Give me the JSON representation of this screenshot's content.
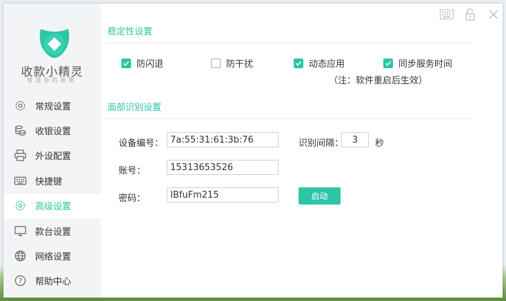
{
  "app": {
    "name": "收款小精灵",
    "slogan": "智慧你的收银"
  },
  "colors": {
    "accent": "#2bc6a6"
  },
  "sidebar": {
    "items": [
      {
        "label": "常规设置",
        "icon": "gear-icon",
        "active": false
      },
      {
        "label": "收银设置",
        "icon": "coins-icon",
        "active": false
      },
      {
        "label": "外设配置",
        "icon": "printer-icon",
        "active": false
      },
      {
        "label": "快捷键",
        "icon": "keyboard-icon",
        "active": false
      },
      {
        "label": "高级设置",
        "icon": "advanced-gear-icon",
        "active": true
      },
      {
        "label": "款台设置",
        "icon": "monitor-icon",
        "active": false
      },
      {
        "label": "网络设置",
        "icon": "globe-icon",
        "active": false
      },
      {
        "label": "帮助中心",
        "icon": "help-icon",
        "active": false
      }
    ]
  },
  "stability": {
    "title": "稳定性设置",
    "options": [
      {
        "label": "防闪退",
        "checked": true
      },
      {
        "label": "防干扰",
        "checked": false
      },
      {
        "label": "动态应用",
        "checked": true
      },
      {
        "label": "同步服务时间",
        "checked": true
      }
    ],
    "note": "（注：软件重启后生效）"
  },
  "face": {
    "title": "面部识别设置",
    "device_label": "设备编号：",
    "device_value": "7a:55:31:61:3b:76",
    "interval_label": "识别间隔：",
    "interval_value": "3",
    "interval_unit": "秒",
    "account_label": "账号：",
    "account_value": "15313653526",
    "password_label": "密码：",
    "password_value": "IBfuFm215",
    "start_button": "启动"
  }
}
